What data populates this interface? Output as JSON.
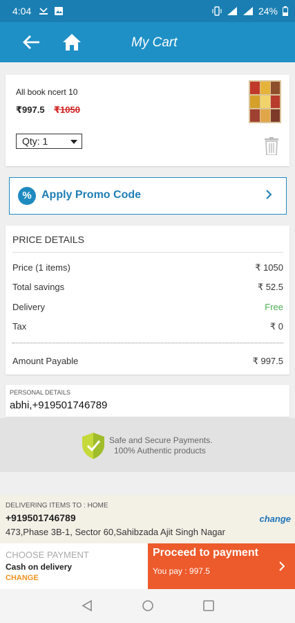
{
  "status_bar": {
    "time": "4:04",
    "battery": "24%"
  },
  "app_bar": {
    "title": "My Cart"
  },
  "cart_item": {
    "title": "All book ncert 10",
    "price": "₹997.5",
    "original_price": "₹1050",
    "quantity": "Qty: 1"
  },
  "promo": {
    "label": "Apply Promo Code",
    "icon_text": "%"
  },
  "price_details": {
    "heading": "PRICE DETAILS",
    "rows": [
      {
        "label": "Price (1 items)",
        "value": "₹ 1050"
      },
      {
        "label": "Total savings",
        "value": "₹ 52.5"
      },
      {
        "label": "Delivery",
        "value": "Free"
      },
      {
        "label": "Tax",
        "value": "₹ 0"
      }
    ],
    "total_label": "Amount Payable",
    "total_value": "₹ 997.5"
  },
  "personal": {
    "label": "PERSONAL DETAILS",
    "value": "abhi,+919501746789"
  },
  "secure": {
    "line1": "Safe and Secure Payments.",
    "line2": "100% Authentic products"
  },
  "delivery": {
    "label": "DELIVERING ITEMS TO : HOME",
    "phone": "+919501746789",
    "address": "473,Phase 3B-1,  Sector 60,Sahibzada Ajit Singh Nagar",
    "change": "change"
  },
  "payment": {
    "label": "CHOOSE PAYMENT",
    "method": "Cash on delivery",
    "change": "CHANGE"
  },
  "proceed": {
    "title": "Proceed to payment",
    "pay": "You pay : 997.5"
  },
  "colors": {
    "status_bar": "#1a7eb2",
    "app_bar": "#1e90c6",
    "proceed": "#ed5a2b",
    "change_orange": "#f0921e",
    "free_green": "#4caf50",
    "strike_red": "#d0201f"
  }
}
